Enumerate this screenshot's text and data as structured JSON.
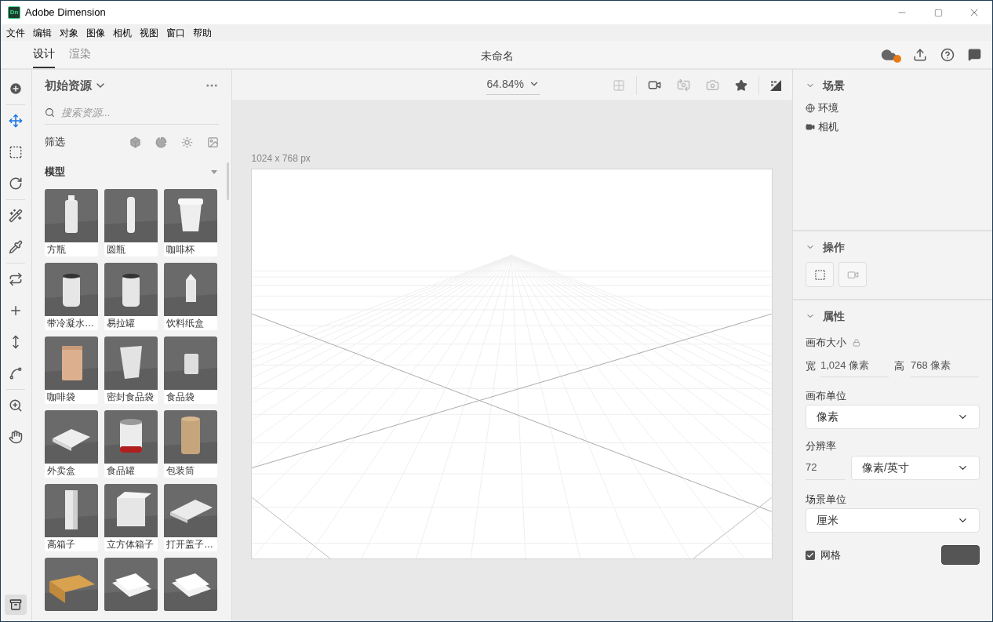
{
  "window": {
    "title": "Adobe Dimension",
    "logo": "Dn"
  },
  "menu": [
    "文件",
    "编辑",
    "对象",
    "图像",
    "相机",
    "视图",
    "窗口",
    "帮助"
  ],
  "tabs": [
    {
      "label": "设计",
      "selected": true
    },
    {
      "label": "渲染",
      "selected": false
    }
  ],
  "document_title": "未命名",
  "tools": [
    {
      "selected": false
    },
    {
      "selected": true
    },
    {
      "selected": false
    },
    {
      "selected": false
    },
    {
      "selected": false
    },
    {
      "selected": false
    },
    {
      "selected": false
    },
    {
      "selected": false
    },
    {
      "selected": false
    },
    {
      "selected": false
    },
    {
      "selected": false
    },
    {
      "selected": false
    }
  ],
  "assets": {
    "title": "初始资源",
    "search": {
      "placeholder": "搜索资源..."
    },
    "filter_label": "筛选",
    "section": "模型",
    "items": [
      {
        "label": "方瓶",
        "kind": "bottle"
      },
      {
        "label": "圆瓶",
        "kind": "slim"
      },
      {
        "label": "咖啡杯",
        "kind": "cup"
      },
      {
        "label": "带冷凝水…",
        "kind": "can"
      },
      {
        "label": "易拉罐",
        "kind": "can"
      },
      {
        "label": "饮料纸盒",
        "kind": "carton"
      },
      {
        "label": "咖啡袋",
        "kind": "bag"
      },
      {
        "label": "密封食品袋",
        "kind": "pouch"
      },
      {
        "label": "食品袋",
        "kind": "sachet"
      },
      {
        "label": "外卖盒",
        "kind": "tray"
      },
      {
        "label": "食品罐",
        "kind": "tin"
      },
      {
        "label": "包装筒",
        "kind": "tube"
      },
      {
        "label": "高箱子",
        "kind": "tall"
      },
      {
        "label": "立方体箱子",
        "kind": "cube"
      },
      {
        "label": "打开盖子…",
        "kind": "lid"
      },
      {
        "kind": "parcel"
      },
      {
        "kind": "cards"
      },
      {
        "kind": "cards"
      }
    ]
  },
  "viewport": {
    "zoom": "64.84%",
    "canvas_size": "1024 x 768 px"
  },
  "scene": {
    "title": "场景",
    "items": [
      {
        "label": "环境",
        "kind": "globe"
      },
      {
        "label": "相机",
        "kind": "camera"
      }
    ]
  },
  "actions": {
    "title": "操作"
  },
  "properties": {
    "title": "属性",
    "canvas_size_label": "画布大小",
    "width_label": "宽",
    "width": "1,024 像素",
    "height_label": "高",
    "height": "768 像素",
    "canvas_unit_label": "画布单位",
    "canvas_unit": "像素",
    "resolution_label": "分辨率",
    "resolution": "72",
    "resolution_unit": "像素/英寸",
    "scene_unit_label": "场景单位",
    "scene_unit": "厘米",
    "grid": {
      "label": "网格",
      "checked": true
    }
  }
}
